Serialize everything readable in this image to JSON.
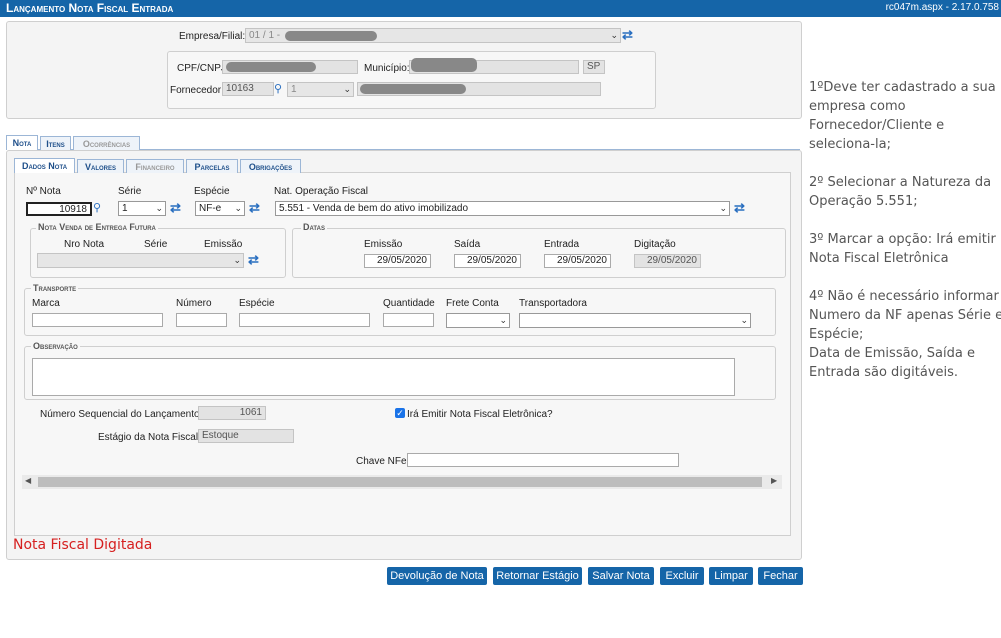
{
  "header": {
    "title": "Lançamento Nota Fiscal Entrada",
    "version": "rc047m.aspx - 2.17.0.758"
  },
  "top": {
    "empresa_label": "Empresa/Filial:",
    "empresa_value": "01 / 1 -",
    "cpf_label": "CPF/CNPJ:",
    "municipio_label": "Município:",
    "uf_value": "SP",
    "fornecedor_label": "Fornecedor:",
    "fornecedor_code": "10163",
    "fornecedor_select": "1"
  },
  "main_tabs": [
    "Nota",
    "Itens",
    "Ocorrências"
  ],
  "sub_tabs": [
    "Dados Nota",
    "Valores",
    "Financeiro",
    "Parcelas",
    "Obrigações"
  ],
  "nota": {
    "nro_label": "Nº Nota",
    "nro_value": "10918",
    "serie_label": "Série",
    "serie_value": "1",
    "especie_label": "Espécie",
    "especie_value": "NF-e",
    "natop_label": "Nat. Operação Fiscal",
    "natop_value": "5.551 - Venda de bem do ativo imobilizado"
  },
  "venda_futura": {
    "legend": "Nota Venda de Entrega Futura",
    "col1": "Nro Nota",
    "col2": "Série",
    "col3": "Emissão"
  },
  "datas": {
    "legend": "Datas",
    "emissao_label": "Emissão",
    "emissao_value": "29/05/2020",
    "saida_label": "Saída",
    "saida_value": "29/05/2020",
    "entrada_label": "Entrada",
    "entrada_value": "29/05/2020",
    "digitacao_label": "Digitação",
    "digitacao_value": "29/05/2020"
  },
  "transporte": {
    "legend": "Transporte",
    "marca": "Marca",
    "numero": "Número",
    "especie": "Espécie",
    "quantidade": "Quantidade",
    "frete": "Frete Conta",
    "transportadora": "Transportadora"
  },
  "observacao": {
    "legend": "Observação"
  },
  "footer_fields": {
    "seq_label": "Número Sequencial do Lançamento:",
    "seq_value": "1061",
    "emitir_label": "Irá Emitir Nota Fiscal Eletrônica?",
    "estagio_label": "Estágio da Nota Fiscal:",
    "estagio_value": "Estoque",
    "chave_label": "Chave NFe:"
  },
  "status_text": "Nota Fiscal Digitada",
  "buttons": [
    "Devolução de Nota",
    "Retornar Estágio",
    "Salvar Nota",
    "Excluir",
    "Limpar",
    "Fechar"
  ],
  "notes": [
    "1ºDeve ter cadastrado a sua",
    "empresa como",
    "Fornecedor/Cliente e",
    "seleciona-la;",
    "2º Selecionar a Natureza da",
    "Operação 5.551;",
    "3º Marcar a opção: Irá emitir",
    "Nota Fiscal Eletrônica",
    "4º Não é necessário informar",
    "Numero da NF apenas Série e",
    "Espécie;",
    "Data de Emissão, Saída e",
    "Entrada são digitáveis."
  ],
  "colors": {
    "header_bg": "#1565a8",
    "button_bg": "#1565a8",
    "status_red": "#d62020",
    "icon_blue": "#2a6fc0"
  }
}
